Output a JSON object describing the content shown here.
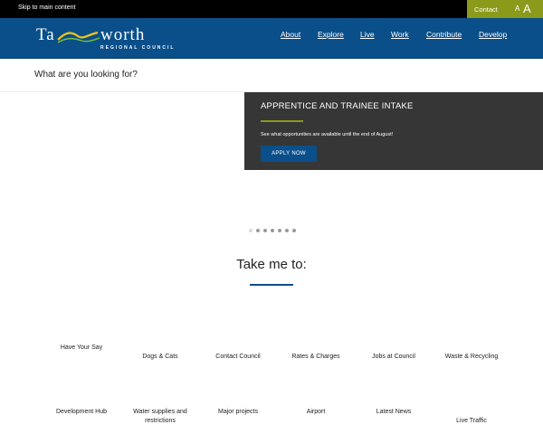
{
  "topbar": {
    "skip_label": "Skip to main content",
    "contact_label": "Contact",
    "font_small": "A",
    "font_large": "A"
  },
  "header": {
    "logo_left": "Ta",
    "logo_right": "worth",
    "logo_sub": "REGIONAL COUNCIL",
    "nav": [
      "About",
      "Explore",
      "Live",
      "Work",
      "Contribute",
      "Develop"
    ]
  },
  "search": {
    "placeholder": "What are you looking for?"
  },
  "promo": {
    "title": "APPRENTICE AND TRAINEE INTAKE",
    "text": "See what opportunities are available until the end of August!",
    "button_label": "APPLY NOW"
  },
  "carousel": {
    "count": 7,
    "active": 0
  },
  "take_me_to": {
    "title": "Take me to:",
    "row1": [
      "Have Your Say",
      "Dogs & Cats",
      "Contact Council",
      "Rates & Charges",
      "Jobs at Council",
      "Waste & Recycling"
    ],
    "row2": [
      "Development Hub",
      "Water supplies and restrictions",
      "Major projects",
      "Airport",
      "Latest News",
      "Live Traffic"
    ]
  },
  "colors": {
    "brand_blue": "#0a4f8a",
    "accent_olive": "#8c9a1b",
    "promo_bg": "#363636"
  }
}
